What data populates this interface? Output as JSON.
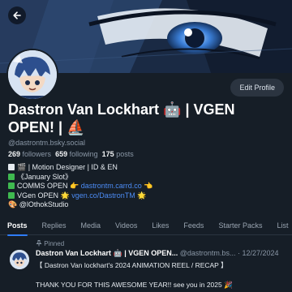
{
  "header": {
    "back_icon": "arrow-left-icon",
    "edit_profile": "Edit Profile"
  },
  "profile": {
    "display_name": "Dastron Van Lockhart 🤖 | VGEN OPEN! | ⛵",
    "handle": "@dastrontm.bsky.social",
    "followers_count": "269",
    "followers_label": "followers",
    "following_count": "659",
    "following_label": "following",
    "posts_count": "175",
    "posts_label": "posts",
    "bio": {
      "line1": "🎬 | Motion Designer | ID & EN",
      "line2": "《January Slot》",
      "line3_text": "COMMS OPEN 👉",
      "line3_link": "dastrontm.carrd.co",
      "line3_suffix": "👈",
      "line4_text": "VGen OPEN 🌟",
      "line4_link": "vgen.co/DastronTM",
      "line4_suffix": "🌟",
      "line5": "🎨 @lOthokStudio"
    }
  },
  "tabs": [
    {
      "label": "Posts"
    },
    {
      "label": "Replies"
    },
    {
      "label": "Media"
    },
    {
      "label": "Videos"
    },
    {
      "label": "Likes"
    },
    {
      "label": "Feeds"
    },
    {
      "label": "Starter Packs"
    },
    {
      "label": "List"
    }
  ],
  "pinned_post": {
    "pinned_label": "Pinned",
    "author": "Dastron Van Lockhart 🤖 | VGEN OPEN...",
    "handle": "@dastrontm.bs...",
    "separator": "·",
    "date": "12/27/2024",
    "line1": "【 Dastron Van lockhart's 2024 ANIMATION REEL / RECAP 】",
    "line2": "THANK YOU FOR THIS AWESOME YEAR!! see you in 2025 🎉"
  },
  "colors": {
    "background": "#161e27",
    "accent": "#2f7cf6",
    "link": "#4c8cf5"
  }
}
